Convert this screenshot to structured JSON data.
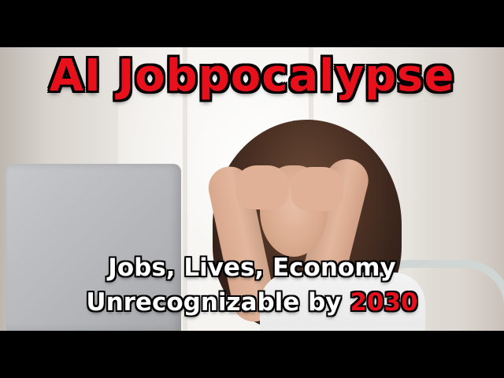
{
  "thumbnail": {
    "title": "AI Jobpocalypse",
    "subtitle_line1": "Jobs, Lives, Economy",
    "subtitle_line2_prefix": "Unrecognizable by ",
    "subtitle_line2_year": "2030"
  },
  "colors": {
    "title_red": "#e8101a",
    "subtitle_white": "#ffffff",
    "outline_black": "#000000",
    "letterbox_black": "#000000"
  },
  "scene": {
    "subject": "woman-stressed-hands-in-hair",
    "objects": [
      "laptop",
      "window",
      "chair"
    ]
  }
}
